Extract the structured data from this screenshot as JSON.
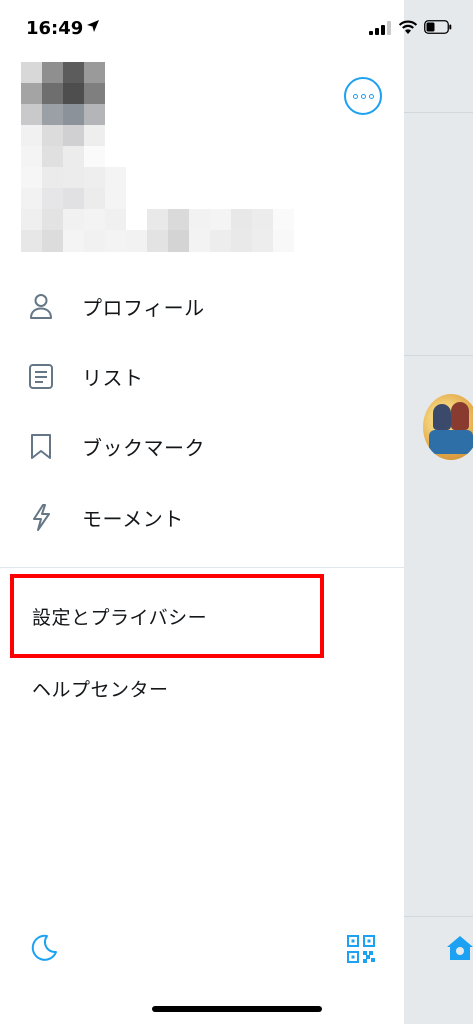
{
  "status_bar": {
    "time": "16:49"
  },
  "menu": {
    "items": [
      {
        "label": "プロフィール",
        "icon": "person-icon"
      },
      {
        "label": "リスト",
        "icon": "list-icon"
      },
      {
        "label": "ブックマーク",
        "icon": "bookmark-icon"
      },
      {
        "label": "モーメント",
        "icon": "lightning-icon"
      }
    ],
    "settings": "設定とプライバシー",
    "help": "ヘルプセンター"
  },
  "footer": {
    "left_icon": "moon-icon",
    "right_icon": "qr-code-icon"
  },
  "colors": {
    "accent": "#1da1f2",
    "icon_gray": "#657786",
    "highlight": "#ff0000",
    "overlay": "#e6e9ec"
  }
}
